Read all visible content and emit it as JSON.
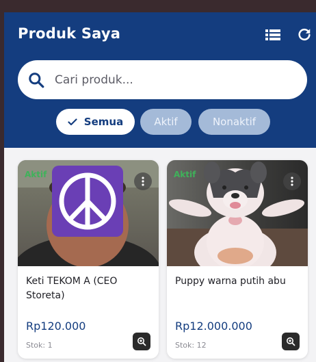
{
  "header": {
    "title": "Produk Saya",
    "icons": [
      "list-icon",
      "refresh-icon"
    ]
  },
  "search": {
    "placeholder": "Cari produk..."
  },
  "filters": [
    {
      "label": "Semua",
      "selected": true
    },
    {
      "label": "Aktif",
      "selected": false
    },
    {
      "label": "Nonaktif",
      "selected": false
    }
  ],
  "products": [
    {
      "status": "Aktif",
      "name": "Keti TEKOM A (CEO Storeta)",
      "price": "Rp120.000",
      "stock": "Stok: 1"
    },
    {
      "status": "Aktif",
      "name": "Puppy warna putih abu",
      "price": "Rp12.000.000",
      "stock": "Stok: 12"
    }
  ],
  "colors": {
    "primary": "#143d7f",
    "chip_inactive": "#a4bad8",
    "status_active": "#3fb25a"
  }
}
